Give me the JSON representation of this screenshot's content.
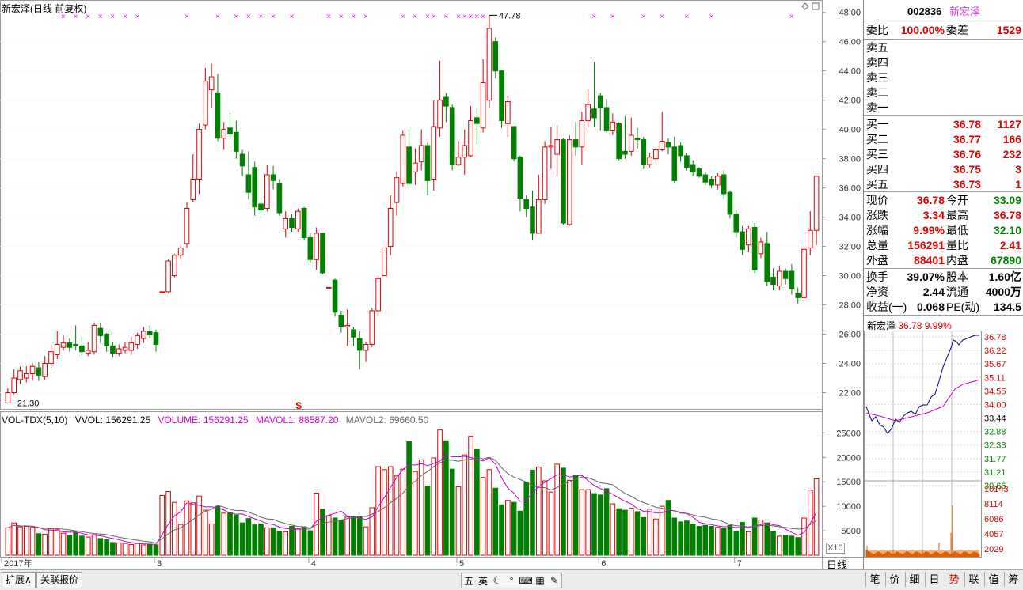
{
  "main": {
    "title": "新宏泽(日线 前复权)",
    "high_mark": "47.78",
    "low_mark": "21.30",
    "s_marker": "S",
    "y_labels": [
      "48.00",
      "46.00",
      "44.00",
      "42.00",
      "40.00",
      "38.00",
      "36.00",
      "34.00",
      "32.00",
      "30.00",
      "28.00",
      "26.00",
      "24.00",
      "22.00"
    ],
    "vol_y_labels": [
      "25000",
      "20000",
      "15000",
      "10000",
      "5000"
    ],
    "x_labels": [
      "2017年",
      "3",
      "4",
      "5",
      "6",
      "7"
    ],
    "vol_scale": "X10",
    "period_label": "日线"
  },
  "volume": {
    "indicator": "VOL-TDX(5,10)",
    "vvol": "VVOL: 156291.25",
    "volume": "VOLUME: 156291.25",
    "mavol1": "MAVOL1: 88587.20",
    "mavol2": "MAVOL2: 69660.50"
  },
  "quote": {
    "code": "002836",
    "name": "新宏泽",
    "wei_bi_label": "委比",
    "wei_bi": "100.00%",
    "wei_cha_label": "委差",
    "wei_cha": "1529",
    "asks": [
      {
        "label": "卖五"
      },
      {
        "label": "卖四"
      },
      {
        "label": "卖三"
      },
      {
        "label": "卖二"
      },
      {
        "label": "卖一"
      }
    ],
    "bids": [
      {
        "label": "买一",
        "price": "36.78",
        "vol": "1127"
      },
      {
        "label": "买二",
        "price": "36.77",
        "vol": "166"
      },
      {
        "label": "买三",
        "price": "36.76",
        "vol": "232"
      },
      {
        "label": "买四",
        "price": "36.75",
        "vol": "3"
      },
      {
        "label": "买五",
        "price": "36.73",
        "vol": "1"
      }
    ],
    "stats": [
      {
        "l": "现价",
        "v": "36.78",
        "vc": "red",
        "l2": "今开",
        "v2": "33.09",
        "v2c": "green"
      },
      {
        "l": "涨跌",
        "v": "3.34",
        "vc": "red",
        "l2": "最高",
        "v2": "36.78",
        "v2c": "red"
      },
      {
        "l": "涨幅",
        "v": "9.99%",
        "vc": "red",
        "l2": "最低",
        "v2": "32.10",
        "v2c": "green"
      },
      {
        "l": "总量",
        "v": "156291",
        "vc": "red",
        "l2": "量比",
        "v2": "2.41",
        "v2c": "red"
      },
      {
        "l": "外盘",
        "v": "88401",
        "vc": "red",
        "l2": "内盘",
        "v2": "67890",
        "v2c": "green"
      }
    ],
    "fund": [
      {
        "l": "换手",
        "v": "39.07%",
        "l2": "股本",
        "v2": "1.60亿"
      },
      {
        "l": "净资",
        "v": "2.44",
        "l2": "流通",
        "v2": "4000万"
      },
      {
        "l": "收益(一)",
        "v": "0.068",
        "l2": "PE(动)",
        "v2": "134.5"
      }
    ]
  },
  "mini": {
    "name": "新宏泽",
    "price": "36.78",
    "pct": "9.99%",
    "price_labels": [
      "36.78",
      "36.22",
      "35.67",
      "35.11",
      "34.55",
      "34.00",
      "33.44",
      "32.88",
      "32.33",
      "31.77",
      "31.21",
      "30.66"
    ],
    "vol_labels": [
      "10143",
      "8114",
      "6086",
      "4057",
      "2029"
    ]
  },
  "bottom": {
    "tabs": [
      "扩展∧",
      "关联报价"
    ],
    "ime": [
      "五",
      "英",
      "☾",
      "°",
      "⌨",
      "▦",
      "✎"
    ],
    "right_tabs": [
      "笔",
      "价",
      "细",
      "日",
      "势",
      "联",
      "值",
      "筹"
    ]
  },
  "colors": {
    "up": "#e00000",
    "down": "#008000",
    "ma1": "#cc00cc",
    "ma2": "#666666",
    "marker": "#ff00ff"
  },
  "chart_data": {
    "type": "candlestick",
    "price_range": [
      21.0,
      48.2
    ],
    "candles": [
      [
        21.3,
        22.0,
        21.3,
        22.3
      ],
      [
        22.0,
        23.0,
        21.9,
        23.6
      ],
      [
        22.9,
        23.5,
        22.6,
        23.8
      ],
      [
        23.0,
        23.3,
        22.7,
        23.8
      ],
      [
        23.3,
        23.8,
        22.8,
        24.0
      ],
      [
        23.7,
        23.2,
        22.8,
        24.1
      ],
      [
        23.1,
        24.0,
        22.9,
        24.5
      ],
      [
        24.0,
        24.8,
        23.7,
        25.3
      ],
      [
        24.6,
        25.3,
        24.3,
        26.2
      ],
      [
        25.1,
        25.4,
        24.9,
        25.9
      ],
      [
        25.4,
        25.1,
        24.8,
        25.7
      ],
      [
        25.3,
        25.2,
        24.9,
        26.6
      ],
      [
        25.2,
        24.8,
        24.5,
        25.8
      ],
      [
        24.7,
        24.9,
        24.5,
        25.5
      ],
      [
        24.8,
        26.6,
        24.6,
        26.8
      ],
      [
        26.4,
        25.9,
        25.4,
        26.8
      ],
      [
        26.0,
        25.2,
        24.8,
        26.1
      ],
      [
        25.2,
        24.7,
        24.4,
        25.5
      ],
      [
        24.7,
        25.0,
        24.5,
        25.3
      ],
      [
        24.9,
        25.1,
        24.7,
        25.5
      ],
      [
        24.9,
        25.4,
        24.6,
        25.8
      ],
      [
        25.3,
        25.9,
        25.0,
        26.1
      ],
      [
        25.7,
        26.2,
        25.4,
        26.5
      ],
      [
        26.2,
        26.0,
        25.7,
        26.6
      ],
      [
        26.1,
        25.3,
        24.8,
        26.3
      ],
      [
        28.9,
        28.9,
        28.9,
        28.9
      ],
      [
        28.9,
        31.0,
        28.8,
        31.1
      ],
      [
        30.0,
        31.4,
        29.9,
        31.5
      ],
      [
        31.4,
        31.9,
        31.1,
        32.0
      ],
      [
        32.2,
        34.6,
        31.9,
        35.0
      ],
      [
        35.2,
        36.6,
        35.0,
        38.3
      ],
      [
        36.6,
        40.0,
        35.6,
        40.4
      ],
      [
        40.3,
        43.3,
        40.0,
        44.2
      ],
      [
        42.7,
        43.6,
        41.5,
        44.5
      ],
      [
        42.5,
        39.4,
        39.2,
        43.8
      ],
      [
        39.4,
        40.0,
        38.6,
        40.5
      ],
      [
        40.1,
        39.7,
        38.7,
        41.1
      ],
      [
        39.8,
        38.5,
        38.0,
        40.6
      ],
      [
        38.3,
        37.5,
        36.8,
        38.6
      ],
      [
        36.9,
        35.7,
        35.2,
        38.5
      ],
      [
        37.4,
        34.7,
        34.1,
        37.8
      ],
      [
        34.9,
        34.5,
        33.9,
        35.1
      ],
      [
        34.6,
        36.9,
        34.4,
        37.6
      ],
      [
        36.9,
        36.5,
        35.9,
        37.5
      ],
      [
        36.3,
        34.3,
        34.1,
        36.6
      ],
      [
        33.2,
        33.9,
        32.6,
        34.4
      ],
      [
        33.9,
        33.3,
        33.0,
        34.2
      ],
      [
        33.2,
        34.4,
        33.0,
        34.6
      ],
      [
        34.6,
        32.6,
        32.4,
        34.7
      ],
      [
        32.6,
        31.1,
        30.9,
        32.9
      ],
      [
        31.1,
        32.9,
        30.4,
        33.3
      ],
      [
        32.9,
        30.2,
        30.1,
        32.9
      ],
      [
        29.2,
        29.2,
        29.2,
        29.2
      ],
      [
        29.7,
        27.5,
        27.2,
        29.8
      ],
      [
        27.3,
        26.5,
        26.1,
        27.6
      ],
      [
        26.5,
        26.6,
        25.2,
        27.7
      ],
      [
        26.3,
        25.8,
        25.2,
        26.5
      ],
      [
        25.7,
        24.9,
        23.6,
        26.2
      ],
      [
        24.9,
        25.3,
        24.1,
        25.5
      ],
      [
        25.3,
        27.6,
        25.1,
        27.8
      ],
      [
        27.6,
        29.8,
        27.3,
        30.0
      ],
      [
        30.0,
        31.9,
        30.5,
        31.6
      ],
      [
        32.0,
        34.6,
        31.4,
        35.5
      ],
      [
        35.0,
        36.7,
        34.1,
        37.1
      ],
      [
        36.3,
        39.6,
        36.1,
        39.9
      ],
      [
        38.8,
        36.3,
        36.2,
        40.0
      ],
      [
        37.1,
        37.7,
        36.2,
        38.7
      ],
      [
        37.8,
        38.9,
        37.2,
        40.0
      ],
      [
        38.9,
        36.5,
        35.5,
        39.1
      ],
      [
        36.6,
        40.2,
        35.8,
        42.0
      ],
      [
        40.1,
        42.0,
        39.5,
        44.7
      ],
      [
        42.2,
        41.6,
        40.5,
        42.5
      ],
      [
        41.5,
        37.6,
        37.2,
        41.7
      ],
      [
        37.6,
        38.1,
        37.5,
        39.2
      ],
      [
        38.1,
        38.9,
        36.9,
        40.0
      ],
      [
        38.2,
        40.6,
        38.1,
        41.6
      ],
      [
        40.8,
        40.4,
        39.0,
        41.5
      ],
      [
        40.1,
        43.2,
        39.8,
        44.8
      ],
      [
        42.0,
        46.9,
        41.5,
        47.8
      ],
      [
        46.0,
        44.0,
        43.5,
        46.3
      ],
      [
        44.0,
        40.6,
        40.1,
        42.9
      ],
      [
        40.4,
        41.9,
        39.5,
        42.3
      ],
      [
        40.2,
        38.0,
        37.8,
        40.2
      ],
      [
        38.1,
        35.3,
        34.4,
        38.2
      ],
      [
        35.2,
        34.6,
        34.0,
        35.5
      ],
      [
        34.7,
        32.9,
        32.4,
        35.8
      ],
      [
        32.9,
        35.2,
        33.6,
        36.9
      ],
      [
        35.2,
        38.8,
        34.9,
        39.2
      ],
      [
        38.8,
        38.9,
        37.3,
        40.2
      ],
      [
        38.3,
        39.3,
        36.8,
        40.3
      ],
      [
        39.3,
        33.6,
        33.5,
        39.4
      ],
      [
        33.5,
        39.3,
        33.4,
        39.6
      ],
      [
        39.3,
        38.8,
        38.2,
        40.5
      ],
      [
        38.8,
        40.6,
        37.6,
        41.2
      ],
      [
        40.6,
        41.7,
        40.1,
        42.7
      ],
      [
        41.4,
        40.8,
        40.2,
        44.6
      ],
      [
        42.3,
        41.5,
        39.9,
        42.5
      ],
      [
        41.5,
        39.9,
        39.8,
        42.1
      ],
      [
        39.9,
        40.5,
        39.6,
        41.1
      ],
      [
        40.4,
        38.0,
        37.9,
        40.5
      ],
      [
        38.5,
        38.3,
        38.0,
        40.9
      ],
      [
        38.5,
        39.6,
        38.2,
        40.8
      ],
      [
        39.4,
        39.3,
        38.7,
        40.1
      ],
      [
        39.3,
        37.6,
        37.3,
        39.5
      ],
      [
        37.6,
        38.1,
        37.4,
        38.4
      ],
      [
        38.0,
        38.6,
        37.8,
        38.8
      ],
      [
        38.6,
        39.2,
        38.5,
        41.2
      ],
      [
        39.1,
        38.8,
        38.3,
        39.4
      ],
      [
        38.8,
        36.5,
        36.3,
        39.5
      ],
      [
        38.9,
        38.2,
        37.8,
        39.1
      ],
      [
        38.2,
        37.4,
        37.2,
        38.4
      ],
      [
        37.6,
        37.1,
        36.8,
        37.9
      ],
      [
        37.3,
        36.8,
        36.7,
        37.4
      ],
      [
        36.9,
        36.4,
        36.2,
        37.1
      ],
      [
        36.6,
        36.2,
        36.0,
        36.8
      ],
      [
        36.2,
        36.8,
        35.9,
        37.0
      ],
      [
        36.9,
        35.6,
        35.2,
        37.2
      ],
      [
        35.7,
        34.2,
        33.9,
        35.8
      ],
      [
        34.2,
        33.0,
        32.6,
        34.5
      ],
      [
        33.0,
        31.8,
        31.4,
        33.4
      ],
      [
        32.1,
        33.2,
        31.6,
        33.4
      ],
      [
        33.3,
        30.4,
        30.2,
        33.6
      ],
      [
        31.5,
        32.3,
        31.2,
        32.6
      ],
      [
        32.2,
        29.6,
        29.3,
        33.0
      ],
      [
        29.9,
        29.4,
        29.0,
        30.5
      ],
      [
        29.3,
        30.3,
        29.0,
        30.7
      ],
      [
        30.3,
        29.8,
        29.4,
        30.5
      ],
      [
        30.3,
        29.1,
        28.7,
        30.8
      ],
      [
        28.8,
        28.5,
        28.1,
        29.2
      ],
      [
        28.5,
        31.8,
        28.4,
        32.0
      ],
      [
        31.9,
        33.1,
        31.4,
        34.4
      ],
      [
        33.1,
        36.8,
        32.1,
        36.8
      ]
    ],
    "volumes": [
      5.6,
      6.6,
      5.8,
      5.9,
      5.7,
      4.4,
      4.3,
      5.4,
      5.2,
      4.5,
      4.1,
      4.6,
      3.9,
      3.7,
      4.2,
      3.4,
      3.2,
      2.6,
      2.5,
      2.4,
      2.2,
      2.4,
      2.1,
      2.2,
      2.1,
      12.2,
      13.0,
      10.8,
      6.3,
      11.1,
      10.7,
      12.1,
      9.2,
      6.4,
      10.0,
      8.6,
      8.7,
      8.2,
      6.6,
      7.5,
      6.2,
      6.4,
      5.6,
      5.6,
      4.9,
      4.8,
      5.9,
      5.4,
      5.8,
      5.0,
      12.7,
      9.4,
      8.1,
      7.6,
      7.1,
      7.8,
      7.9,
      7.9,
      5.8,
      9.7,
      18.1,
      17.5,
      18.1,
      16.2,
      17.6,
      23.2,
      17.1,
      19.5,
      14.1,
      19.9,
      25.6,
      23.4,
      17.6,
      14.0,
      20.5,
      24.3,
      21.6,
      15.9,
      17.5,
      13.7,
      10.3,
      11.2,
      10.8,
      9.0,
      14.9,
      17.4,
      18.0,
      15.2,
      12.9,
      18.6,
      17.8,
      15.3,
      16.4,
      13.4,
      13.4,
      12.6,
      12.3,
      13.6,
      10.5,
      9.5,
      9.2,
      9.6,
      8.9,
      7.7,
      9.4,
      7.4,
      10.0,
      11.2,
      7.6,
      6.8,
      7.0,
      6.3,
      5.9,
      6.1,
      5.9,
      5.7,
      5.5,
      6.1,
      4.9,
      6.7,
      4.8,
      7.6,
      7.2,
      6.6,
      4.9,
      3.9,
      4.1,
      3.9,
      3.6,
      7.6,
      13.3,
      15.6
    ]
  }
}
